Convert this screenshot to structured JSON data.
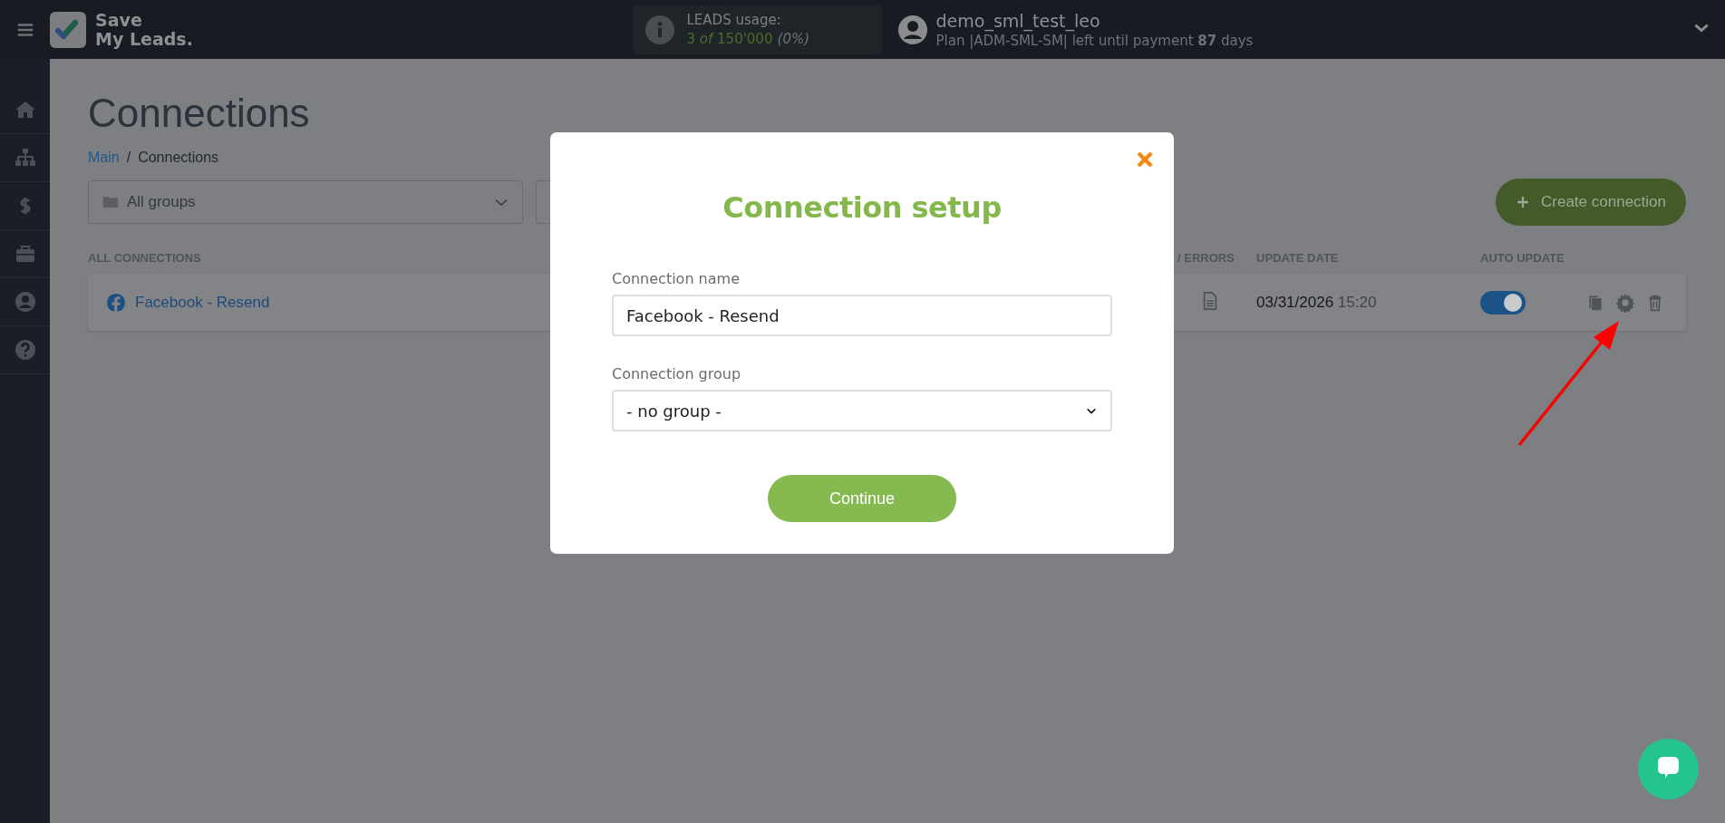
{
  "topbar": {
    "logo_text": [
      "Save",
      "My Leads."
    ],
    "usage": {
      "label": "LEADS usage:",
      "count": "3 *of* 150'000",
      "percent": "(0%)"
    },
    "user": {
      "name": "demo_sml_test_leo",
      "plan": "Plan |ADM-SML-SM| left until payment **87** days"
    }
  },
  "page": {
    "title": "Connections",
    "breadcrumb": [
      {
        "label": "Main",
        "kind": "link"
      },
      {
        "label": "/",
        "kind": "separator"
      },
      {
        "label": "Connections",
        "kind": "current"
      }
    ],
    "group_filter": "All groups",
    "create_button": "Create connection"
  },
  "table": {
    "columns": [
      "ALL CONNECTIONS",
      "/ ERRORS",
      "UPDATE DATE",
      "AUTO UPDATE"
    ],
    "rows": [
      {
        "name": "Facebook - Resend",
        "date": "03/31/2026",
        "time": "15:20",
        "auto_update": true
      }
    ]
  },
  "modal": {
    "title": "Connection setup",
    "fields": [
      {
        "label": "Connection name",
        "kind": "text",
        "value": "Facebook - Resend"
      },
      {
        "label": "Connection group",
        "kind": "select",
        "value": "- no group -"
      }
    ],
    "button": "Continue"
  }
}
